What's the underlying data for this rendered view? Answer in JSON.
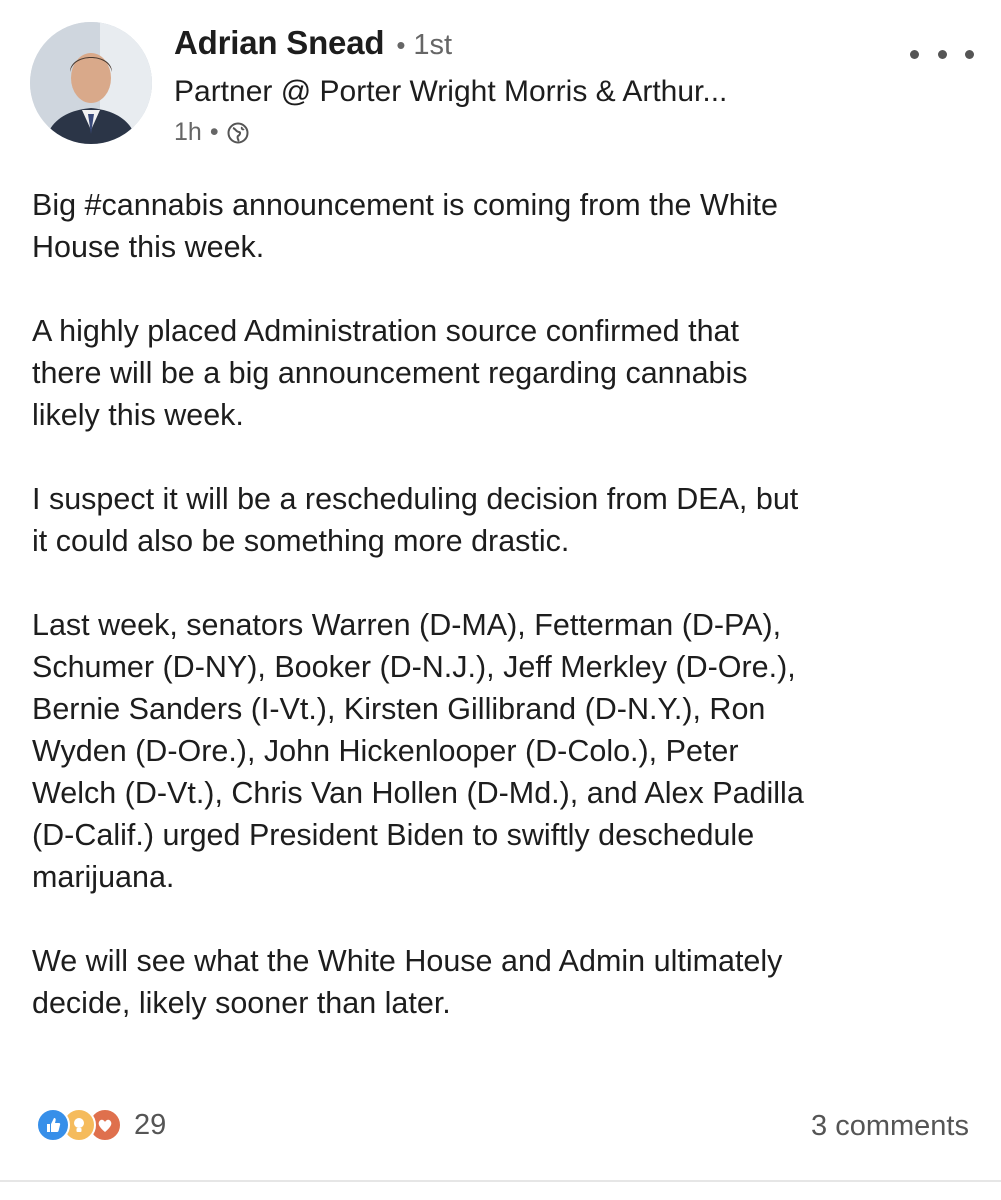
{
  "author": {
    "name": "Adrian Snead",
    "separator": "•",
    "degree": "1st",
    "headline": "Partner @ Porter Wright Morris & Arthur...",
    "time": "1h",
    "meta_separator": "•",
    "visibility_icon": "globe-icon",
    "avatar_icon": "profile-photo"
  },
  "menu": {
    "icon": "more-horizontal-icon"
  },
  "post": {
    "paragraphs": [
      "Big #cannabis announcement is coming from the White\nHouse this week.",
      "A highly placed Administration source confirmed that\nthere will be a big announcement regarding cannabis\nlikely this week.",
      "I suspect it will be a rescheduling decision from DEA, but\nit could also be something more drastic.",
      "Last week, senators Warren (D-MA), Fetterman (D-PA),\nSchumer (D-NY), Booker (D-N.J.), Jeff Merkley (D-Ore.),\nBernie Sanders (I-Vt.), Kirsten Gillibrand (D-N.Y.), Ron\nWyden (D-Ore.), John Hickenlooper (D-Colo.), Peter\nWelch (D-Vt.), Chris Van Hollen (D-Md.), and Alex Padilla\n(D-Calif.) urged President Biden to swiftly deschedule\nmarijuana.",
      "We will see what the White House and Admin ultimately\ndecide, likely sooner than later."
    ]
  },
  "social": {
    "reaction_icons": [
      "like-icon",
      "insightful-icon",
      "love-icon"
    ],
    "reaction_count": "29",
    "comments": "3 comments"
  },
  "colors": {
    "like": "#378fe9",
    "insightful": "#f5bb5c",
    "love": "#df704d",
    "secondary_text": "#666666"
  }
}
